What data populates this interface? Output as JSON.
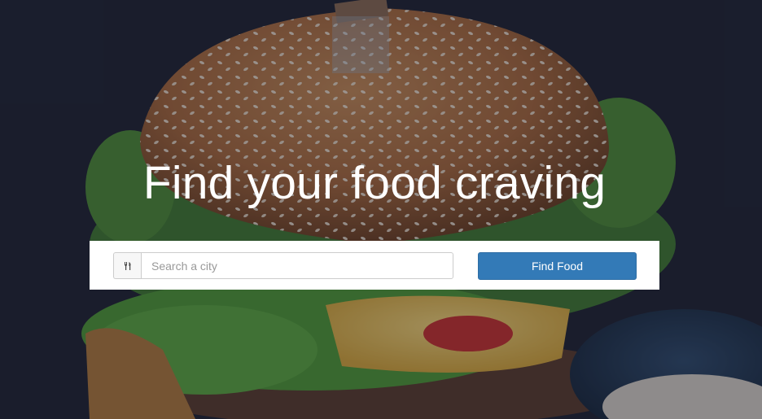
{
  "hero": {
    "headline": "Find your food craving",
    "background": "burger-photo"
  },
  "search": {
    "icon": "cutlery-icon",
    "placeholder": "Search a city",
    "value": "",
    "button_label": "Find Food"
  },
  "colors": {
    "button": "#337ab7",
    "button_border": "#2e6da4",
    "panel": "#ffffff",
    "headline": "#ffffff"
  }
}
